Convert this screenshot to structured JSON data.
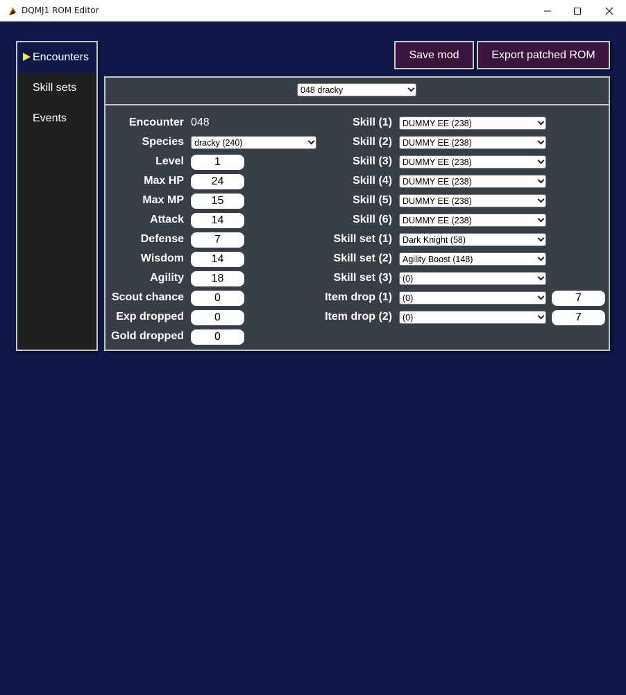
{
  "window": {
    "title": "DQMJ1 ROM Editor",
    "minimize": "—",
    "maximize": "☐",
    "close": "✕"
  },
  "sidebar": {
    "items": [
      {
        "label": "Encounters",
        "active": true
      },
      {
        "label": "Skill sets",
        "active": false
      },
      {
        "label": "Events",
        "active": false
      }
    ]
  },
  "toolbar": {
    "save_label": "Save mod",
    "export_label": "Export patched ROM"
  },
  "encounter_picker": {
    "selected": "048 dracky"
  },
  "stats": {
    "encounter": {
      "label": "Encounter",
      "value": "048"
    },
    "species": {
      "label": "Species",
      "value": "dracky (240)"
    },
    "level": {
      "label": "Level",
      "value": "1"
    },
    "max_hp": {
      "label": "Max HP",
      "value": "24"
    },
    "max_mp": {
      "label": "Max MP",
      "value": "15"
    },
    "attack": {
      "label": "Attack",
      "value": "14"
    },
    "defense": {
      "label": "Defense",
      "value": "7"
    },
    "wisdom": {
      "label": "Wisdom",
      "value": "14"
    },
    "agility": {
      "label": "Agility",
      "value": "18"
    },
    "scout_chance": {
      "label": "Scout chance",
      "value": "0"
    },
    "exp_dropped": {
      "label": "Exp dropped",
      "value": "0"
    },
    "gold_dropped": {
      "label": "Gold dropped",
      "value": "0"
    }
  },
  "skills": [
    {
      "label": "Skill (1)",
      "value": "DUMMY EE (238)"
    },
    {
      "label": "Skill (2)",
      "value": "DUMMY EE (238)"
    },
    {
      "label": "Skill (3)",
      "value": "DUMMY EE (238)"
    },
    {
      "label": "Skill (4)",
      "value": "DUMMY EE (238)"
    },
    {
      "label": "Skill (5)",
      "value": "DUMMY EE (238)"
    },
    {
      "label": "Skill (6)",
      "value": "DUMMY EE (238)"
    }
  ],
  "skill_sets": [
    {
      "label": "Skill set (1)",
      "value": "Dark Knight (58)"
    },
    {
      "label": "Skill set (2)",
      "value": "Agility Boost (148)"
    },
    {
      "label": "Skill set (3)",
      "value": "(0)"
    }
  ],
  "item_drops": [
    {
      "label": "Item drop (1)",
      "value": "(0)",
      "chance": "7"
    },
    {
      "label": "Item drop (2)",
      "value": "(0)",
      "chance": "7"
    }
  ],
  "icons": {
    "app": "dqmj-app-icon",
    "nav_arrow": "play-arrow-icon",
    "dropdown": "chevron-down-icon"
  },
  "colors": {
    "background": "#10184a",
    "panel": "#383e45",
    "sidebar": "#1f1f1f",
    "button": "#3a163e",
    "arrow": "#f4e34a"
  }
}
